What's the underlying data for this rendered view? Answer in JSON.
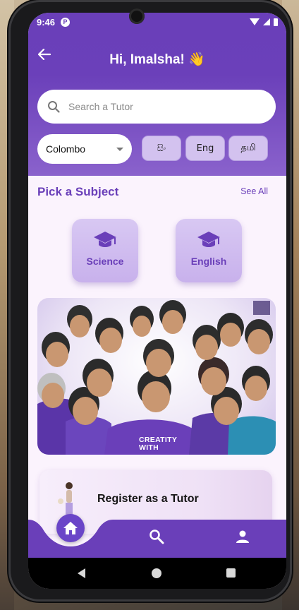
{
  "status_bar": {
    "time": "9:46",
    "app_icon_glyph": "P"
  },
  "header": {
    "greeting": "Hi, Imalsha! 👋"
  },
  "search": {
    "placeholder": "Search a Tutor"
  },
  "location": {
    "selected": "Colombo"
  },
  "languages": [
    "සිං",
    "Eng",
    "தமி"
  ],
  "subjects_section": {
    "title": "Pick a Subject",
    "see_all": "See All",
    "items": [
      {
        "label": "Science",
        "icon": "graduation-cap-icon"
      },
      {
        "label": "English",
        "icon": "graduation-cap-icon"
      }
    ]
  },
  "banner": {
    "shirt_text": [
      "CREATITY",
      "WITH"
    ]
  },
  "register": {
    "title": "Register as a Tutor"
  },
  "bottom_nav": {
    "items": [
      {
        "name": "home",
        "icon": "home-icon",
        "active": true
      },
      {
        "name": "search",
        "icon": "search-icon",
        "active": false
      },
      {
        "name": "profile",
        "icon": "person-icon",
        "active": false
      }
    ]
  },
  "colors": {
    "primary": "#6a3fb9",
    "header_gradient_end": "#8a62cc",
    "subject_card": "#d3c2ef",
    "screen_bg": "#fbf3fd"
  }
}
